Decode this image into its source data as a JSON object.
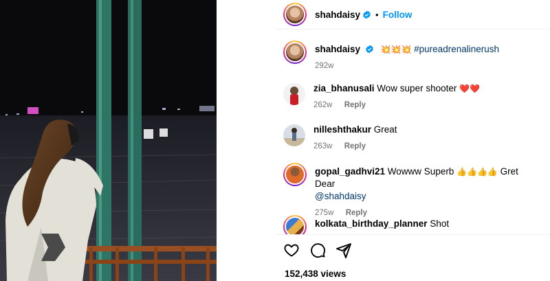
{
  "post": {
    "author": "shahdaisy",
    "follow_label": "Follow",
    "separator": "•",
    "caption": {
      "username": "shahdaisy",
      "emojis": "💥💥💥",
      "hashtag": "#pureadrenalinerush",
      "time": "292w"
    },
    "views": "152,438 views"
  },
  "comments": [
    {
      "username": "zia_bhanusali",
      "text": "Wow super shooter",
      "emojis": "❤️❤️",
      "time": "262w",
      "reply_label": "Reply"
    },
    {
      "username": "nilleshthakur",
      "text": "Great",
      "time": "263w",
      "reply_label": "Reply"
    },
    {
      "username": "gopal_gadhvi21",
      "text": "Wowww Superb",
      "emojis": "👍👍👍👍",
      "text2": "Gret Dear",
      "mention": "@shahdaisy",
      "time": "275w",
      "reply_label": "Reply"
    },
    {
      "username": "kolkata_birthday_planner",
      "text": "Shot"
    }
  ],
  "icons": [
    "heart-icon",
    "comment-icon",
    "share-icon",
    "verified-icon"
  ],
  "colors": {
    "follow": "#0095f6",
    "secondary_text": "#737373",
    "link": "#00376b"
  }
}
